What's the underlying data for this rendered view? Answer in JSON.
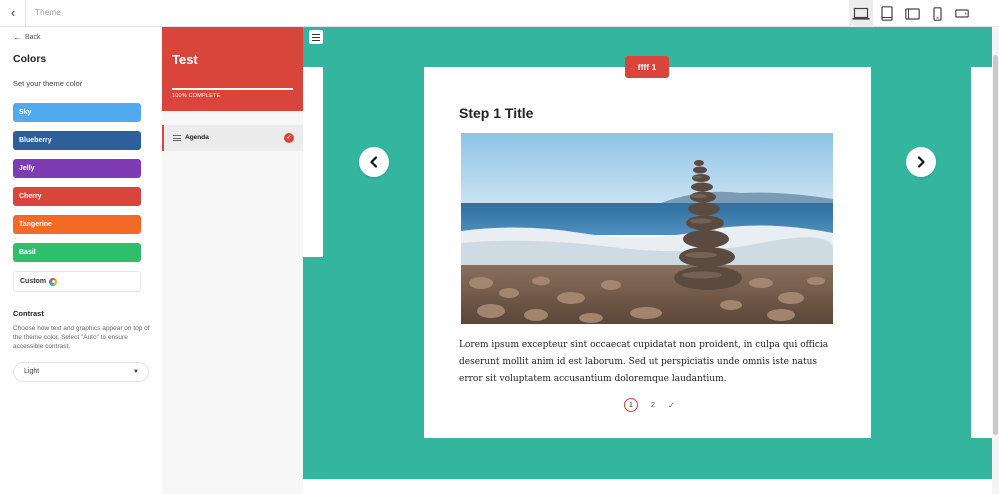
{
  "topbar": {
    "back_glyph": "‹",
    "title": "Theme",
    "devices": [
      {
        "name": "desktop-icon",
        "active": true
      },
      {
        "name": "tablet-portrait-icon",
        "active": false
      },
      {
        "name": "tablet-landscape-icon",
        "active": false
      },
      {
        "name": "phone-portrait-icon",
        "active": false
      },
      {
        "name": "phone-landscape-icon",
        "active": false
      }
    ]
  },
  "sidebar": {
    "back_label": "Back",
    "title": "Colors",
    "subtitle": "Set your theme color",
    "swatches": [
      {
        "label": "Sky",
        "color": "#4faaf0"
      },
      {
        "label": "Blueberry",
        "color": "#2d5f9b"
      },
      {
        "label": "Jelly",
        "color": "#7f3bb3"
      },
      {
        "label": "Cherry",
        "color": "#d9453a"
      },
      {
        "label": "Tangerine",
        "color": "#f26a26"
      },
      {
        "label": "Basil",
        "color": "#2fbf6a"
      }
    ],
    "custom_label": "Custom",
    "contrast_title": "Contrast",
    "contrast_desc": "Choose how text and graphics appear on top of the theme color. Select \"Auto\" to ensure accessible contrast.",
    "contrast_value": "Light"
  },
  "course": {
    "title": "Test",
    "progress_percent": 100,
    "progress_label": "100% COMPLETE",
    "nav_items": [
      {
        "label": "Agenda",
        "completed": true
      }
    ]
  },
  "preview": {
    "badge": "ffff 1",
    "step_title": "Step 1 Title",
    "body": "Lorem ipsum excepteur sint occaecat cupidatat non proident, in culpa qui officia deserunt mollit anim id est laborum. Sed ut perspiciatis unde omnis iste natus error sit voluptatem accusantium doloremque laudantium.",
    "pager": {
      "pages": [
        "1",
        "2"
      ],
      "current": "1"
    }
  },
  "colors": {
    "accent": "#d9453a",
    "stage_bg": "#34b59e"
  }
}
